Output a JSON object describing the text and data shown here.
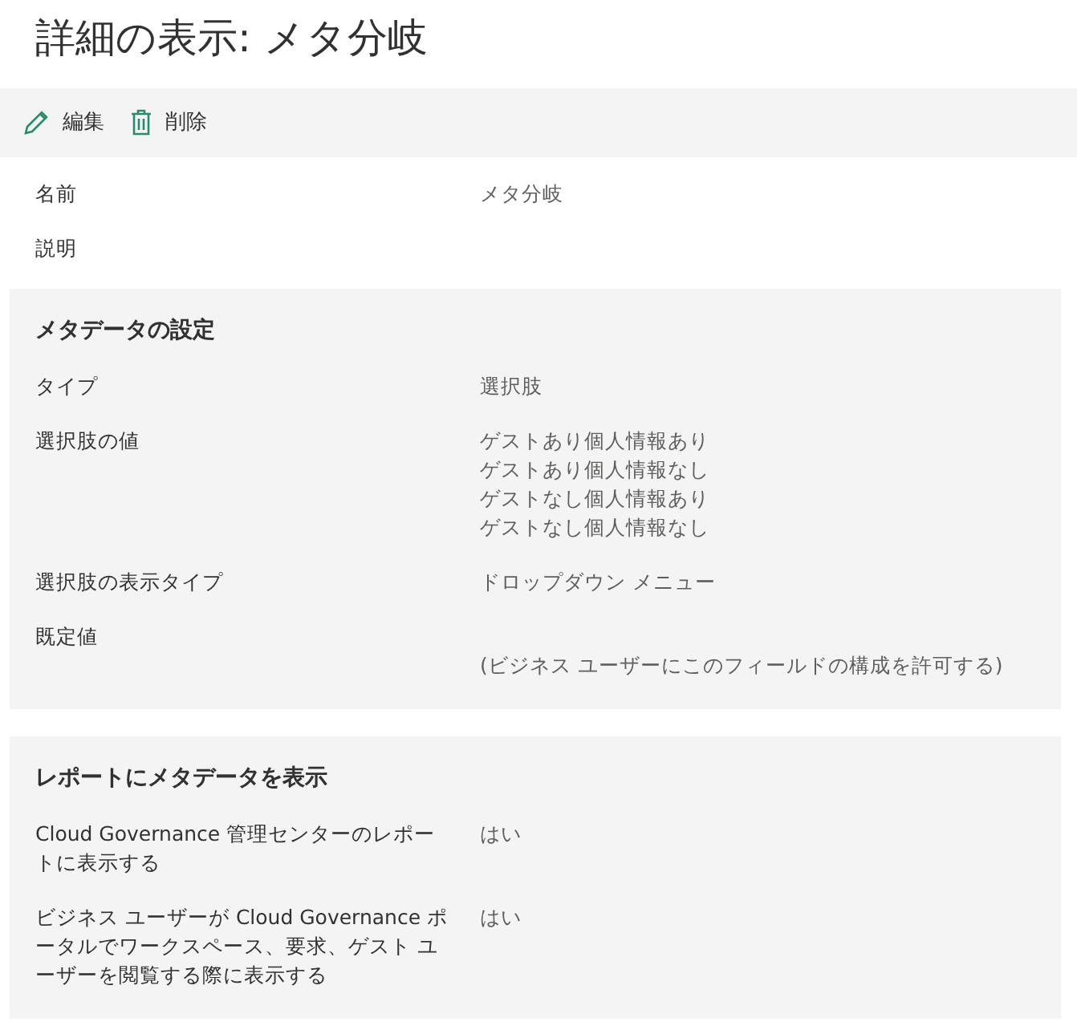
{
  "title": "詳細の表示: メタ分岐",
  "toolbar": [
    {
      "kind": "edit",
      "label": "編集"
    },
    {
      "kind": "delete",
      "label": "削除"
    }
  ],
  "fields": [
    {
      "label": "名前",
      "values": [
        "メタ分岐"
      ]
    },
    {
      "label": "説明"
    }
  ],
  "sections": [
    {
      "heading": "メタデータの設定",
      "rows": [
        {
          "label": "タイプ",
          "values": [
            "選択肢"
          ]
        },
        {
          "label": "選択肢の値",
          "values": [
            "ゲストあり個人情報あり",
            "ゲストあり個人情報なし",
            "ゲストなし個人情報あり",
            "ゲストなし個人情報なし"
          ]
        },
        {
          "label": "選択肢の表示タイプ",
          "values": [
            "ドロップダウン メニュー"
          ]
        },
        {
          "label": "既定値",
          "note": "(ビジネス ユーザーにこのフィールドの構成を許可する)"
        }
      ]
    },
    {
      "heading": "レポートにメタデータを表示",
      "rows": [
        {
          "label": "Cloud Governance 管理センターのレポートに表示する",
          "values": [
            "はい"
          ]
        },
        {
          "label": "ビジネス ユーザーが Cloud Governance ポータルでワークスペース、要求、ゲスト ユーザーを閲覧する際に表示する",
          "values": [
            "はい"
          ]
        }
      ]
    }
  ]
}
